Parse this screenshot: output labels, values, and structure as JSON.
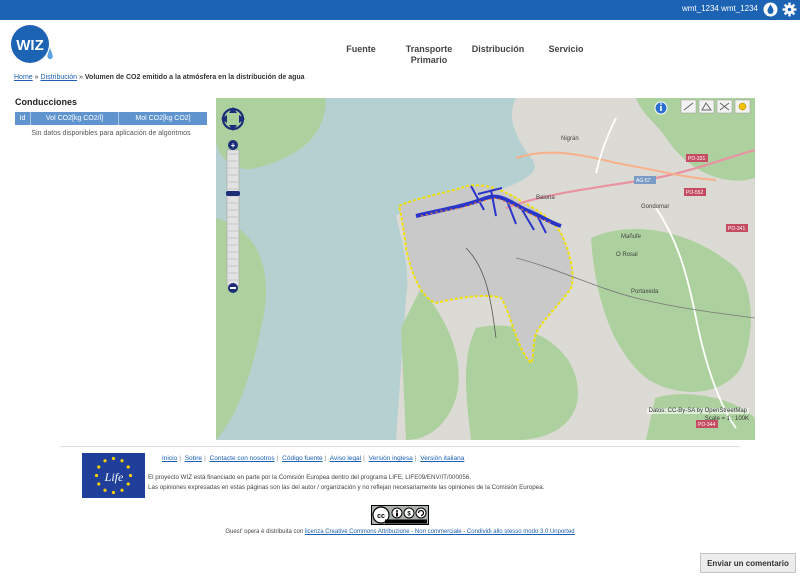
{
  "header": {
    "user": "wmt_1234 wmt_1234",
    "logo_text": "WIZ",
    "nav": [
      {
        "label": "Fuente"
      },
      {
        "label": "Transporte Primario"
      },
      {
        "label": "Distribución"
      },
      {
        "label": "Servicio"
      }
    ]
  },
  "breadcrumb": {
    "home": "Home",
    "sep": "»",
    "section": "Distribución",
    "current": "Volumen de CO2 emitido a la atmósfera en la distribución de agua"
  },
  "panel": {
    "title": "Conducciones",
    "columns": [
      "Id",
      "Vol CO2[kg CO2/l]",
      "Mol CO2[kg CO2]"
    ],
    "empty_message": "Sin datos disponibles para aplicación de algoritmos"
  },
  "map": {
    "attribution": "Datos: CC-By-SA by OpenStreetMap",
    "scale": "Scale = 1 : 100K",
    "place_labels": [
      "Nigrán",
      "Baiona",
      "Gondomar",
      "Mañufe",
      "O Rosal",
      "Portaxeda"
    ],
    "road_labels": [
      "PO-331",
      "AG-57",
      "PO-552",
      "PO-341",
      "PO-344"
    ],
    "colors": {
      "land": "#dcdad4",
      "sea": "#b5d0d0",
      "forest": "#add19e",
      "boundary": "#f2e100",
      "network": "#2a35c9",
      "network_nodes": "#f07a2a"
    }
  },
  "footer": {
    "links": [
      "Inicio",
      "Sobre",
      "Contacte con nosotros",
      "Código fuente",
      "Aviso legal",
      "Versión inglesa",
      "Versión italiana"
    ],
    "text_lines": [
      "El proyecto WIZ está financiado en parte por la Comisión Europea dentro del programa LIFE, LIFE09/ENV/IT/000056.",
      "Las opiniones expresadas en estas páginas son las del autor / organización y no reflejan necesariamente las opiniones de la Comisión Europea."
    ],
    "license_prefix": "Guest' opera è distribuita con",
    "license_link": "licenza Creative Commons Attribuzione - Non commerciale - Condividi allo stesso modo 3.0 Unported"
  },
  "feedback": {
    "button_label": "Enviar un comentario"
  },
  "colors": {
    "brand_blue": "#1c63b3",
    "table_header": "#5f94cf",
    "link": "#1a5fb4"
  }
}
